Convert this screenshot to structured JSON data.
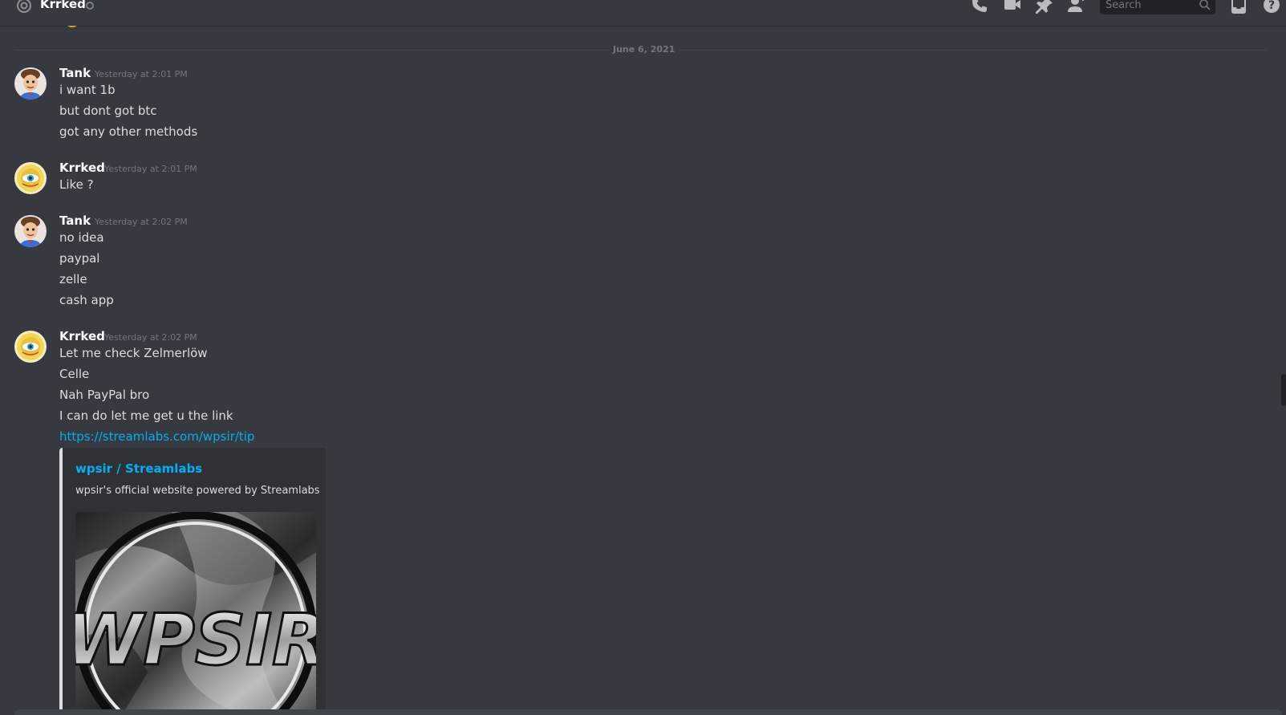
{
  "header": {
    "title": "Krrked",
    "search_placeholder": "Search",
    "icons": [
      "at-icon",
      "phone-call-icon",
      "video-call-icon",
      "pin-icon",
      "add-friend-icon",
      "search-icon",
      "inbox-icon",
      "help-icon"
    ]
  },
  "divider": {
    "label": "June 6, 2021"
  },
  "messages": [
    {
      "author": "Tank",
      "timestamp": "Yesterday at 2:01 PM",
      "lines": [
        "i want 1b",
        "but dont got btc",
        "got any other methods"
      ]
    },
    {
      "author": "Krrked",
      "timestamp": "Yesterday at 2:01 PM",
      "lines": [
        "Like ?"
      ]
    },
    {
      "author": "Tank",
      "timestamp": "Yesterday at 2:02 PM",
      "lines": [
        "no idea",
        "paypal",
        "zelle",
        "cash app"
      ]
    },
    {
      "author": "Krrked",
      "timestamp": "Yesterday at 2:02 PM",
      "lines": [
        "Let me check Zelmerlöw",
        "Celle",
        "Nah PayPal bro",
        "I can do let me get u the link"
      ],
      "link": "https://streamlabs.com/wpsir/tip"
    }
  ],
  "embed": {
    "title": "wpsir / Streamlabs",
    "description": "wpsir's official website powered by Streamlabs",
    "image_text": "WPSIR"
  },
  "colors": {
    "background": "#36393f",
    "link": "#00b0f4",
    "embed_background": "#2f3136",
    "timestamp": "#72767d"
  }
}
